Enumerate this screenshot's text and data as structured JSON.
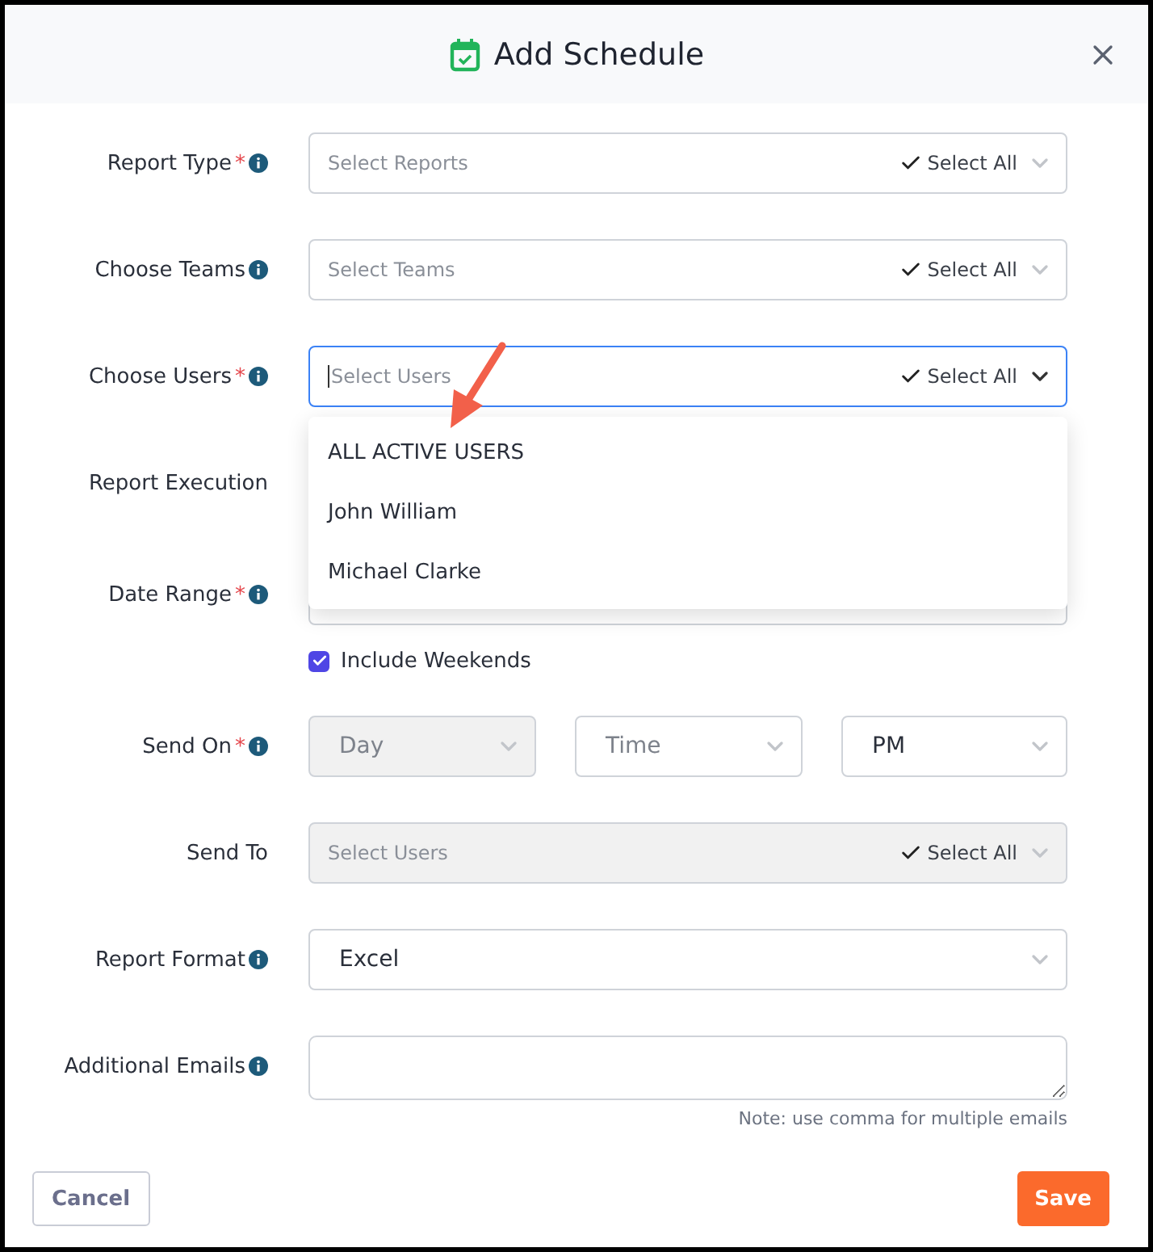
{
  "dialog": {
    "title": "Add Schedule"
  },
  "fields": [
    {
      "kind": "multiselect",
      "label": "Report Type",
      "mark": "*",
      "info": true,
      "placeholder": "Select Reports",
      "select_all": "Select All",
      "disabled": false,
      "focused": false
    },
    {
      "kind": "multiselect",
      "label": "Choose Teams",
      "info": true,
      "placeholder": "Select Teams",
      "select_all": "Select All",
      "disabled": false,
      "focused": false
    },
    {
      "kind": "multiselect",
      "label": "Choose Users",
      "mark": "*",
      "info": true,
      "placeholder": "Select Users",
      "select_all": "Select All",
      "disabled": false,
      "focused": true,
      "expanded": true,
      "options": [
        "ALL ACTIVE USERS",
        "John William",
        "Michael Clarke"
      ]
    },
    {
      "kind": "covered",
      "label": "Report Execution",
      "info": false
    },
    {
      "kind": "select",
      "label": "Date Range",
      "mark": "*",
      "info": true
    },
    {
      "kind": "checkbox",
      "label": "Include Weekends",
      "checked": true
    },
    {
      "kind": "triple",
      "label": "Send On",
      "mark": "*",
      "info": true,
      "selects": [
        {
          "placeholder": "Day",
          "disabled": true
        },
        {
          "placeholder": "Time",
          "disabled": false
        },
        {
          "value": "PM",
          "disabled": false
        }
      ]
    },
    {
      "kind": "multiselect",
      "label": "Send To",
      "info": false,
      "placeholder": "Select Users",
      "select_all": "Select All",
      "disabled": true,
      "focused": false
    },
    {
      "kind": "select",
      "label": "Report Format",
      "info": true,
      "value": "Excel",
      "disabled": false
    },
    {
      "kind": "textarea",
      "label": "Additional Emails",
      "info": true,
      "note": "Note: use comma for multiple emails"
    }
  ],
  "buttons": [
    {
      "kind": "cancel",
      "label": "Cancel"
    },
    {
      "kind": "save",
      "label": "Save"
    }
  ]
}
